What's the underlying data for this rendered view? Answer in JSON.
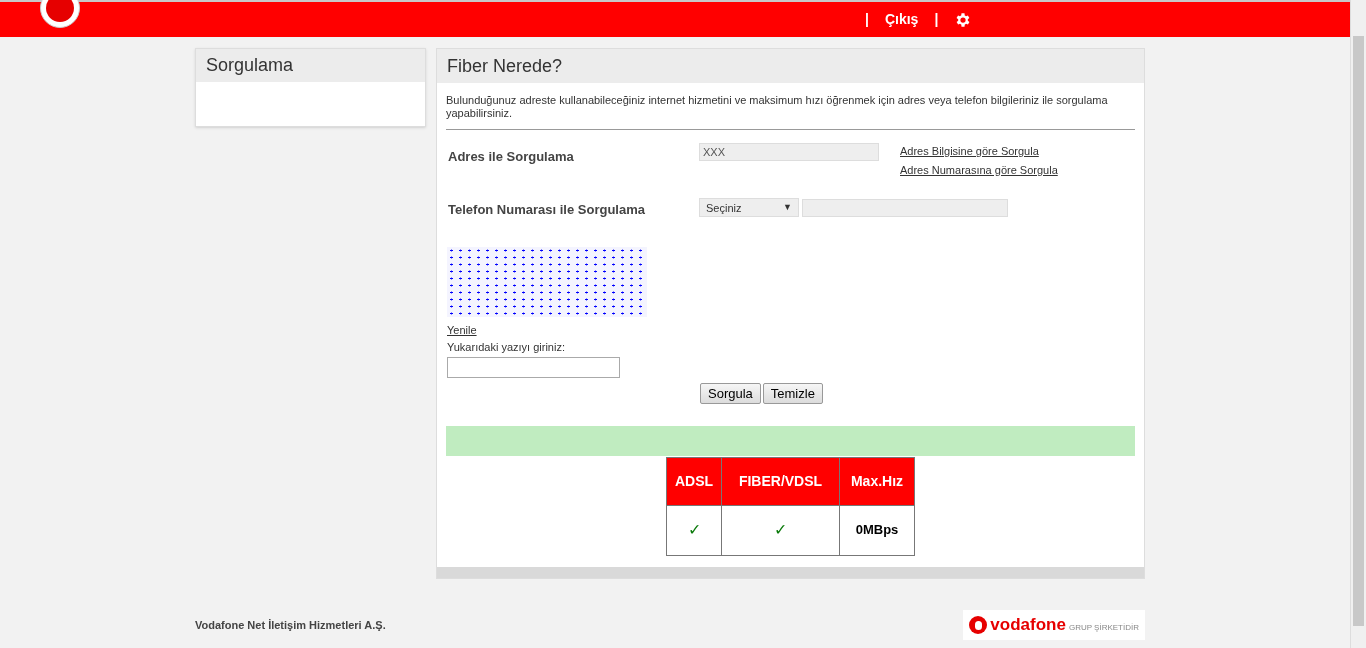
{
  "header": {
    "logout": "Çıkış",
    "separators": [
      "|",
      "|"
    ]
  },
  "sidebar": {
    "title": "Sorgulama"
  },
  "main": {
    "title": "Fiber Nerede?",
    "intro": "Bulunduğunuz adreste kullanabileceğiniz internet hizmetini ve maksimum hızı öğrenmek için adres veya telefon bilgileriniz ile sorgulama yapabilirsiniz.",
    "address": {
      "label": "Adres ile Sorgulama",
      "value": "XXX",
      "links": [
        "Adres Bilgisine göre Sorgula",
        "Adres Numarasına göre Sorgula"
      ]
    },
    "phone": {
      "label": "Telefon Numarası ile Sorgulama",
      "select": "Seçiniz",
      "select_arrow": "▼"
    },
    "captcha": {
      "refresh": "Yenile",
      "prompt": "Yukarıdaki yazıyı giriniz:"
    },
    "buttons": [
      "Sorgula",
      "Temizle"
    ],
    "result_table": {
      "columns": [
        "ADSL",
        "FIBER/VDSL",
        "Max.Hız"
      ],
      "rows": [
        [
          "✓",
          "✓",
          "0MBps"
        ]
      ]
    }
  },
  "footer": {
    "company": "Vodafone Net İletişim Hizmetleri A.Ş.",
    "logo_text": "vodafone",
    "logo_tagline": "GRUP ŞİRKETİDİR"
  }
}
